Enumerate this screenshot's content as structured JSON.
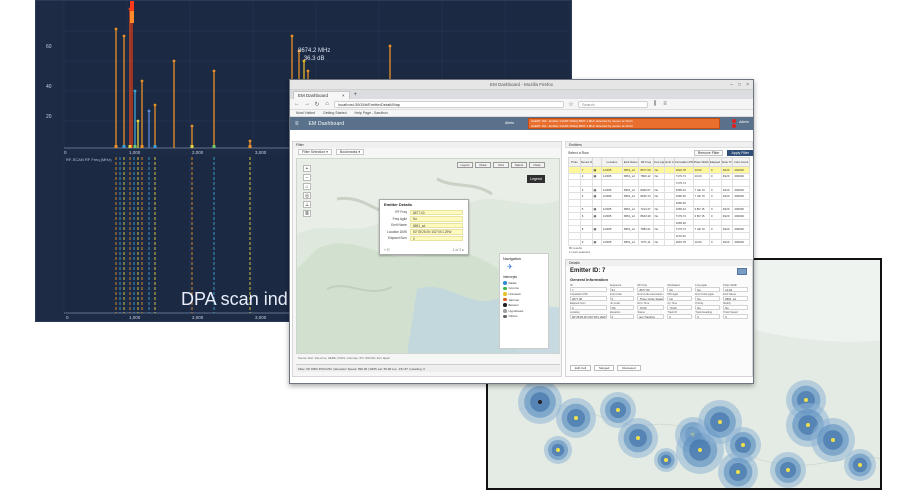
{
  "spectrum": {
    "caption": "DPA scan ind",
    "readout_freq": "8674.2 MHz",
    "readout_db": "36.3 dB",
    "y_ticks": [
      "60",
      "40",
      "20"
    ],
    "x_ticks_top": [
      "0",
      "1,000",
      "2,000",
      "3,000",
      "4,000",
      "5,000",
      "6,000",
      "7,000"
    ],
    "x_ticks_bottom": [
      "0",
      "1,000",
      "2,000",
      "3,000",
      "4,000",
      "5,000",
      "6,000",
      "7,000"
    ],
    "lower_label": "RF-SCAN RF Freq (MHz)"
  },
  "browser": {
    "window_title": "EM Dashboard - Mozilla Firefox",
    "tab_label": "EM Dashboard",
    "tab_close": "×",
    "new_tab": "+",
    "url": "localhost:3000/#/EmitterDetail/Map",
    "search_placeholder": "Search",
    "bookmarks": [
      "Most Visited",
      "Getting Started",
      "Help Page - Sandbox"
    ],
    "app_title": "EM  Dashboard",
    "alerts_label": "Alerts",
    "alert_lines": [
      "ALERT 160 - Emitter 14ADF FREQ 8607.1 MHz detected by sensor at 10:21",
      "ALERT 161 - Emitter 14ADF FREQ 8607.1 MHz detected by sensor at 10:22"
    ],
    "user_label": "Admin"
  },
  "left_pane": {
    "header": "Filter",
    "tools": [
      "Filter Selection ▾",
      "Bookmarks ▾"
    ],
    "map_top_buttons": [
      "Layers",
      "Draw",
      "Grid",
      "Select",
      "Clear"
    ],
    "legend_button": "Legend",
    "popup": {
      "title": "Emitter Details",
      "rows": [
        {
          "k": "RF Freq",
          "v": "8677.00"
        },
        {
          "k": "Freq Agile",
          "v": "No"
        },
        {
          "k": "Emit Name",
          "v": "8651_sd"
        },
        {
          "k": "Location DMS",
          "v": "60°35'25.0N 152°04'1.29W"
        },
        {
          "k": "Elapsed Sum",
          "v": "0"
        }
      ],
      "footer_left": "⌖ ⎘",
      "footer_right": "1 of 2 ▸"
    },
    "legend_panel": {
      "title": "Navigation",
      "subtitle": "Intercepts",
      "items": [
        {
          "label": "Radar",
          "color": "#2e8fd6"
        },
        {
          "label": "Comms",
          "color": "#3bb34a"
        },
        {
          "label": "Unknown",
          "color": "#e6c229"
        },
        {
          "label": "Jammer",
          "color": "#e0601c"
        },
        {
          "label": "Beacon",
          "color": "#222222"
        },
        {
          "label": "Hypothesis",
          "color": "#a0a0a0"
        },
        {
          "label": "Others",
          "color": "#666666"
        }
      ]
    },
    "map_footer": "Source: Esri, DeLorme, HERE, USGS, Intermap, iPC, NRCAN, Esri Japan",
    "status_bar": "Filter: RF 8000-8700 Mhz | Elevation Speed: 890.96 | WMS Lat: 59.98 Lon -151.87 | Heading: 0"
  },
  "right_pane": {
    "header": "Emitters",
    "select_label": "Select a Row",
    "buttons": [
      "Remove Filter",
      "Apply Filter"
    ],
    "columns": [
      "Proto",
      "Sensor ID",
      "",
      "Location",
      "Emit Name",
      "RF Freq",
      "Freq Agile",
      "Emit Code",
      "Correlation PRI",
      "Pulse Width",
      "Elapsed Count",
      "Scan Time",
      "Inter-Count"
    ],
    "rows": [
      [
        "7",
        "▦",
        "1/2005",
        "8651_sd",
        "8677.00",
        "No",
        "",
        "2016.78",
        "10.02",
        "0",
        "D120",
        "200000"
      ],
      [
        "2",
        "▦",
        "1/2005",
        "8651_sd",
        "7800.12",
        "No",
        "",
        "7179.74",
        "10.00",
        "0",
        "D120",
        "200000"
      ],
      [
        "",
        "",
        "",
        "",
        "",
        "",
        "",
        "7179.74",
        "",
        "",
        "",
        ""
      ],
      [
        "3",
        "▦",
        "1/2005",
        "8651_sd",
        "8400.67",
        "No",
        "",
        "3365.44",
        "7 UE 70",
        "0",
        "D120",
        "200000"
      ],
      [
        "4",
        "▦",
        "1/2005",
        "8651_sd",
        "8630.74",
        "No",
        "",
        "1665.30",
        "7 UE 70",
        "0",
        "D120",
        "200000"
      ],
      [
        "",
        "",
        "",
        "",
        "",
        "",
        "",
        "1665.30",
        "",
        "",
        "",
        ""
      ],
      [
        "5",
        "▦",
        "1/2005",
        "8651_sd",
        "7214.27",
        "No",
        "",
        "1665.44",
        "3 BV 15",
        "0",
        "D120",
        "200000"
      ],
      [
        "6",
        "▦",
        "1/2005",
        "8651_sd",
        "8643.39",
        "No",
        "",
        "7179.74",
        "3 BV 15",
        "0",
        "D120",
        "200000"
      ],
      [
        "",
        "",
        "",
        "",
        "",
        "",
        "",
        "1665.30",
        "",
        "",
        "",
        ""
      ],
      [
        "8",
        "▦",
        "1/2005",
        "8651_sd",
        "7884.21",
        "No",
        "",
        "7179.74",
        "7 UE 70",
        "0",
        "D120",
        "200000"
      ],
      [
        "",
        "",
        "",
        "",
        "",
        "",
        "",
        "1179.40",
        "",
        "",
        "",
        ""
      ],
      [
        "9",
        "▦",
        "1/2005",
        "8651_sd",
        "7271.11",
        "No",
        "",
        "2016.78",
        "10.00",
        "0",
        "D120",
        "200000"
      ]
    ],
    "footer_lines": [
      "80 results",
      "1 rows selected"
    ],
    "details": {
      "header": "Details",
      "title": "Emitter ID: 7",
      "subtitle": "General Information",
      "fields": [
        {
          "l": "ID",
          "v": "7"
        },
        {
          "l": "Sequence",
          "v": "61"
        },
        {
          "l": "RF Freq",
          "v": "8677.00"
        },
        {
          "l": "Modulated",
          "v": "No"
        },
        {
          "l": "Freq Agile",
          "v": "No"
        },
        {
          "l": "Pulse Width",
          "v": "10.02"
        },
        {
          "l": "Correlation PRI",
          "v": "2677.00"
        },
        {
          "l": "Emit Code",
          "v": "0"
        },
        {
          "l": "Emit Code Association",
          "v": "Three Circle States"
        },
        {
          "l": "PRI Agile",
          "v": "No"
        },
        {
          "l": "Emit Code Agile",
          "v": "No"
        },
        {
          "l": "Emit Name",
          "v": "8651_sd"
        },
        {
          "l": "Elapsed Sum",
          "v": "0"
        },
        {
          "l": "No Code",
          "v": "NS"
        },
        {
          "l": "Rcvr Time",
          "v": "70.00"
        },
        {
          "l": "Up Time",
          "v": "70.00"
        },
        {
          "l": "Priority",
          "v": "No"
        },
        {
          "l": "Modify",
          "v": "No"
        },
        {
          "l": "Location",
          "v": "60°35'25.0N 152°04'1.29W"
        },
        {
          "l": "Elevation",
          "v": "0"
        },
        {
          "l": "Status",
          "v": "Ext Tracking"
        },
        {
          "l": "Track ID",
          "v": "0"
        },
        {
          "l": "Track Heading",
          "v": "0"
        },
        {
          "l": "Track Speed",
          "v": "0"
        }
      ],
      "buttons": [
        "Edit Cell",
        "Merged",
        "Reviewed"
      ]
    }
  }
}
